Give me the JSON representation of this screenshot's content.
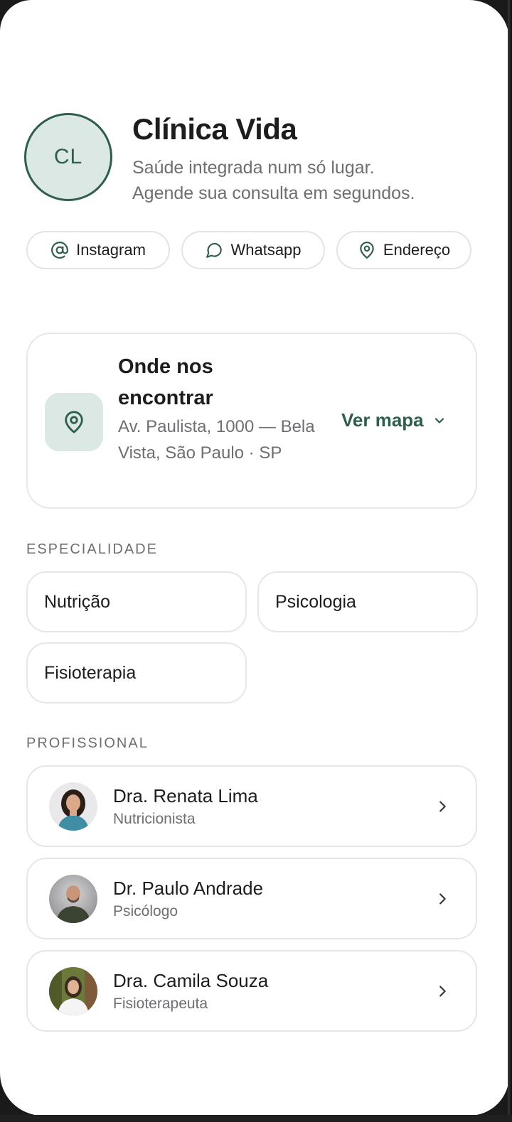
{
  "header": {
    "avatar_initials": "CL",
    "clinic_name": "Clínica Vida",
    "tagline_line1": "Saúde integrada num só lugar.",
    "tagline_line2": "Agende sua consulta em segundos."
  },
  "links": [
    {
      "label": "Instagram",
      "icon": "at-sign-icon"
    },
    {
      "label": "Whatsapp",
      "icon": "chat-bubble-icon"
    },
    {
      "label": "Endereço",
      "icon": "map-pin-icon"
    }
  ],
  "location": {
    "title": "Onde nos encontrar",
    "address": "Av. Paulista, 1000 — Bela Vista, São Paulo · SP",
    "map_button": "Ver mapa",
    "icon": "map-pin-icon"
  },
  "specialty": {
    "label": "ESPECIALIDADE",
    "items": [
      "Nutrição",
      "Psicologia",
      "Fisioterapia"
    ]
  },
  "professional": {
    "label": "PROFISSIONAL",
    "items": [
      {
        "name": "Dra. Renata Lima",
        "role": "Nutricionista"
      },
      {
        "name": "Dr. Paulo Andrade",
        "role": "Psicólogo"
      },
      {
        "name": "Dra. Camila Souza",
        "role": "Fisioterapeuta"
      }
    ]
  },
  "colors": {
    "accent": "#2f5e4c",
    "accent_light": "#dbe8e3",
    "text_primary": "#1d1d1f",
    "text_secondary": "#6e6e73",
    "border": "#e6e6ea"
  }
}
